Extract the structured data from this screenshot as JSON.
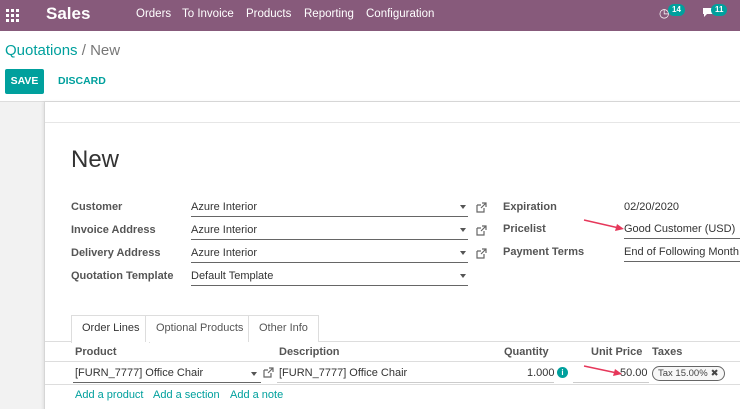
{
  "navbar": {
    "app_name": "Sales",
    "menu": [
      "Orders",
      "To Invoice",
      "Products",
      "Reporting",
      "Configuration"
    ],
    "activity_badge": "14",
    "messages_badge": "11",
    "bar_color": "#875a7b"
  },
  "breadcrumb": {
    "parent": "Quotations",
    "separator": "/",
    "current": "New"
  },
  "buttons": {
    "save": "SAVE",
    "discard": "DISCARD"
  },
  "form": {
    "title": "New",
    "customer_label": "Customer",
    "customer_value": "Azure Interior",
    "invoice_address_label": "Invoice Address",
    "invoice_address_value": "Azure Interior",
    "delivery_address_label": "Delivery Address",
    "delivery_address_value": "Azure Interior",
    "quotation_template_label": "Quotation Template",
    "quotation_template_value": "Default Template",
    "expiration_label": "Expiration",
    "expiration_value": "02/20/2020",
    "pricelist_label": "Pricelist",
    "pricelist_value": "Good Customer (USD)",
    "payment_terms_label": "Payment Terms",
    "payment_terms_value": "End of Following Month"
  },
  "tabs": [
    "Order Lines",
    "Optional Products",
    "Other Info"
  ],
  "order_lines": {
    "columns": {
      "product": "Product",
      "description": "Description",
      "quantity": "Quantity",
      "unit_price": "Unit Price",
      "taxes": "Taxes"
    },
    "rows": [
      {
        "product": "[FURN_7777] Office Chair",
        "description": "[FURN_7777] Office Chair",
        "quantity": "1.000",
        "unit_price": "50.00",
        "tax": "Tax 15.00%"
      }
    ],
    "add_links": [
      "Add a product",
      "Add a section",
      "Add a note"
    ]
  },
  "colors": {
    "accent": "#00a09d",
    "annotation_arrow": "#e6375a"
  }
}
